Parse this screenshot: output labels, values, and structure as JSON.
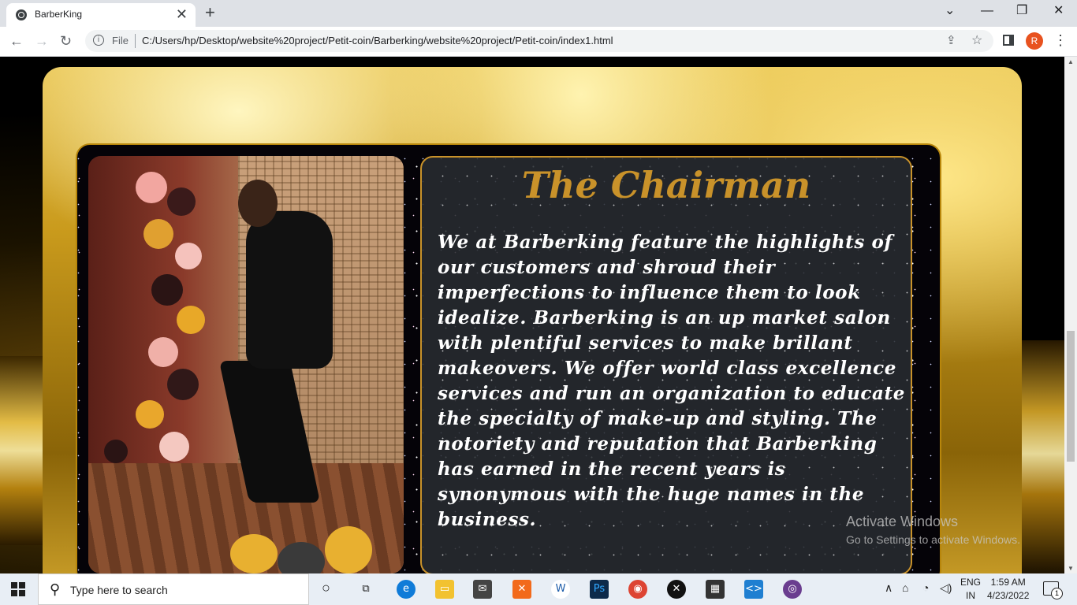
{
  "browser": {
    "tab_title": "BarberKing",
    "tab_close": "✕",
    "new_tab": "+",
    "file_label": "File",
    "url": "C:/Users/hp/Desktop/website%20project/Petit-coin/Barberking/website%20project/Petit-coin/index1.html",
    "profile_initial": "R",
    "controls": {
      "tab_search": "⌄",
      "minimize": "—",
      "restore": "❐",
      "close": "✕"
    }
  },
  "section": {
    "heading": "The Chairman",
    "body": "We at Barberking feature the highlights of our customers and shroud their imperfections to influence them to look idealize. Barberking is an up market salon with plentiful services to make brillant makeovers. We offer world class excellence services and run an organization to educate the specialty of make-up and styling. The notoriety and reputation that Barberking has earned in the recent years is synonymous with the huge names in the business."
  },
  "watermark": {
    "title": "Activate Windows",
    "subtitle": "Go to Settings to activate Windows."
  },
  "taskbar": {
    "search_placeholder": "Type here to search",
    "language": "ENG",
    "region": "IN",
    "time": "1:59 AM",
    "date": "4/23/2022",
    "notification_count": "1"
  },
  "colors": {
    "accent_gold": "#c9922a",
    "card_bg": "#282b30",
    "profile": "#e8521f"
  }
}
